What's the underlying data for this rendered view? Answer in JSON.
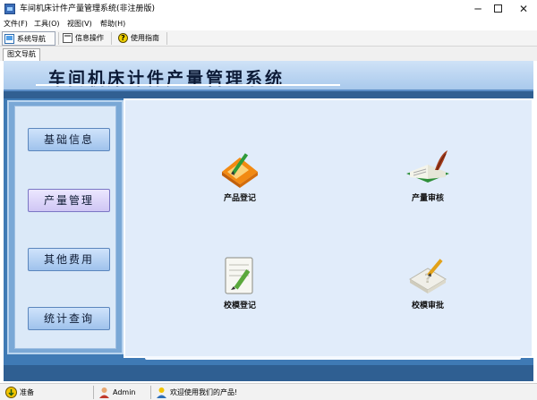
{
  "window": {
    "title": "车间机床计件产量管理系统(非注册版)",
    "minimize_glyph": "─",
    "close_glyph": "✕"
  },
  "menu": [
    {
      "label": "文件(F)"
    },
    {
      "label": "工具(O)"
    },
    {
      "label": "视图(V)"
    },
    {
      "label": "帮助(H)"
    }
  ],
  "toolbar": {
    "nav_label": "系统导航",
    "info_label": "信息操作",
    "help_label": "使用指南",
    "help_glyph": "?"
  },
  "tab": {
    "label": "图文导航"
  },
  "header": {
    "title": "车间机床计件产量管理系统"
  },
  "nav": [
    {
      "label": "基础信息"
    },
    {
      "label": "产量管理",
      "selected": true
    },
    {
      "label": "其他费用"
    },
    {
      "label": "统计查询"
    }
  ],
  "functions": [
    {
      "label": "产品登记",
      "icon": "product-register-icon"
    },
    {
      "label": "产量审核",
      "icon": "output-audit-icon"
    },
    {
      "label": "校模登记",
      "icon": "mold-register-icon"
    },
    {
      "label": "校模审批",
      "icon": "mold-approve-icon"
    }
  ],
  "status": {
    "state": "准备",
    "user": "Admin",
    "message": "欢迎使用我们的产品!"
  },
  "colors": {
    "frame_blue": "#3f7ab5",
    "content_bg": "#e1ecfa",
    "nav_button": "#9fc2ec",
    "nav_selected": "#cfc6f4"
  }
}
